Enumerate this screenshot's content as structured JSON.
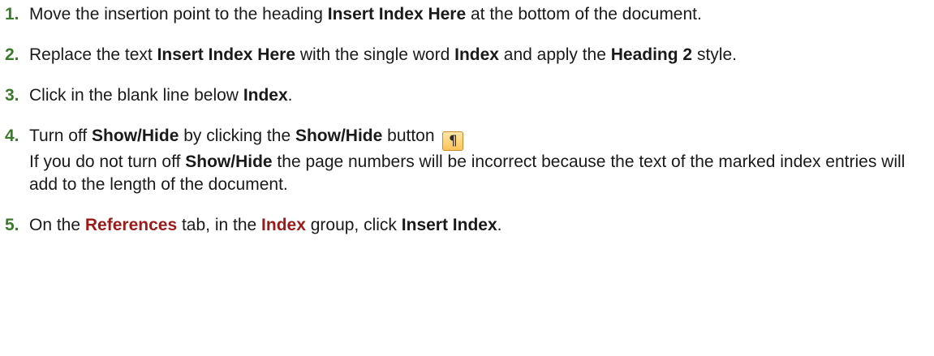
{
  "steps": [
    {
      "num": "1.",
      "t1": "Move the insertion point to the heading ",
      "b1": "Insert Index Here",
      "t2": " at the bottom of the document."
    },
    {
      "num": "2.",
      "t1": "Replace the text ",
      "b1": "Insert Index Here",
      "t2": " with the single word ",
      "b2": "Index",
      "t3": " and apply the ",
      "b3": "Heading 2",
      "t4": " style."
    },
    {
      "num": "3.",
      "t1": "Click in the blank line below ",
      "b1": "Index",
      "t2": "."
    },
    {
      "num": "4.",
      "t1": "Turn off ",
      "b1": "Show/Hide",
      "t2": " by clicking the ",
      "b2": "Show/Hide",
      "t3": " button ",
      "icon": "pilcrow-icon",
      "glyph": "¶",
      "t4": "If you do not turn off ",
      "b3": "Show/Hide",
      "t5": " the page numbers will be incorrect because the text of the marked index entries will add to the length of the document."
    },
    {
      "num": "5.",
      "t1": "On the ",
      "r1": "References",
      "t2": " tab, in the ",
      "r2": "Index",
      "t3": " group, click ",
      "b1": "Insert Index",
      "t4": "."
    }
  ],
  "colors": {
    "step_number": "#3a7a2a",
    "ribbon_term": "#9b1b1b",
    "button_fill": "#ffc45a"
  }
}
